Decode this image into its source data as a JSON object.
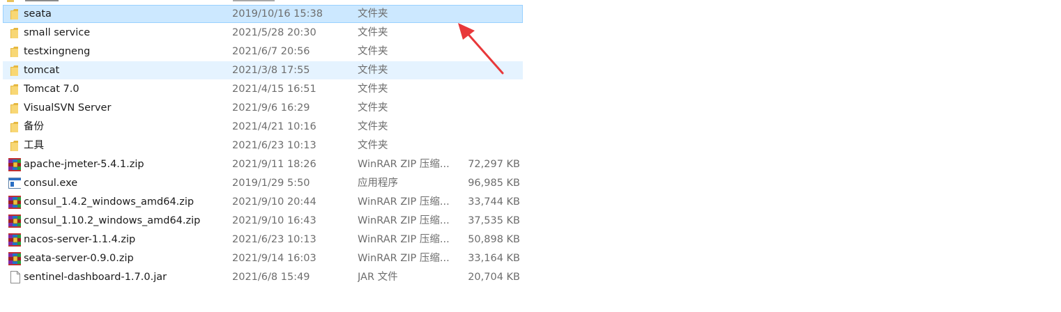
{
  "files": [
    {
      "name": "seata",
      "date": "2019/10/16 15:38",
      "type": "文件夹",
      "size": "",
      "icon": "folder-icon",
      "state": "selected"
    },
    {
      "name": "small service",
      "date": "2021/5/28 20:30",
      "type": "文件夹",
      "size": "",
      "icon": "folder-icon",
      "state": ""
    },
    {
      "name": "testxingneng",
      "date": "2021/6/7 20:56",
      "type": "文件夹",
      "size": "",
      "icon": "folder-icon",
      "state": ""
    },
    {
      "name": "tomcat",
      "date": "2021/3/8 17:55",
      "type": "文件夹",
      "size": "",
      "icon": "folder-icon",
      "state": "hover"
    },
    {
      "name": "Tomcat 7.0",
      "date": "2021/4/15 16:51",
      "type": "文件夹",
      "size": "",
      "icon": "folder-icon",
      "state": ""
    },
    {
      "name": "VisualSVN Server",
      "date": "2021/9/6 16:29",
      "type": "文件夹",
      "size": "",
      "icon": "folder-icon",
      "state": ""
    },
    {
      "name": "备份",
      "date": "2021/4/21 10:16",
      "type": "文件夹",
      "size": "",
      "icon": "folder-icon",
      "state": ""
    },
    {
      "name": "工具",
      "date": "2021/6/23 10:13",
      "type": "文件夹",
      "size": "",
      "icon": "folder-icon",
      "state": ""
    },
    {
      "name": "apache-jmeter-5.4.1.zip",
      "date": "2021/9/11 18:26",
      "type": "WinRAR ZIP 压缩...",
      "size": "72,297 KB",
      "icon": "winrar-zip-icon",
      "state": ""
    },
    {
      "name": "consul.exe",
      "date": "2019/1/29 5:50",
      "type": "应用程序",
      "size": "96,985 KB",
      "icon": "application-icon",
      "state": ""
    },
    {
      "name": "consul_1.4.2_windows_amd64.zip",
      "date": "2021/9/10 20:44",
      "type": "WinRAR ZIP 压缩...",
      "size": "33,744 KB",
      "icon": "winrar-zip-icon",
      "state": ""
    },
    {
      "name": "consul_1.10.2_windows_amd64.zip",
      "date": "2021/9/10 16:43",
      "type": "WinRAR ZIP 压缩...",
      "size": "37,535 KB",
      "icon": "winrar-zip-icon",
      "state": ""
    },
    {
      "name": "nacos-server-1.1.4.zip",
      "date": "2021/6/23 10:13",
      "type": "WinRAR ZIP 压缩...",
      "size": "50,898 KB",
      "icon": "winrar-zip-icon",
      "state": ""
    },
    {
      "name": "seata-server-0.9.0.zip",
      "date": "2021/9/14 16:03",
      "type": "WinRAR ZIP 压缩...",
      "size": "33,164 KB",
      "icon": "winrar-zip-icon",
      "state": ""
    },
    {
      "name": "sentinel-dashboard-1.7.0.jar",
      "date": "2021/6/8 15:49",
      "type": "JAR 文件",
      "size": "20,704 KB",
      "icon": "jar-file-icon",
      "state": ""
    }
  ],
  "colors": {
    "selected_bg": "#cce8ff",
    "selected_border": "#99d1ff",
    "hover_bg": "#e5f3ff",
    "folder": "#f8d775",
    "annotation_arrow": "#e8383a"
  }
}
